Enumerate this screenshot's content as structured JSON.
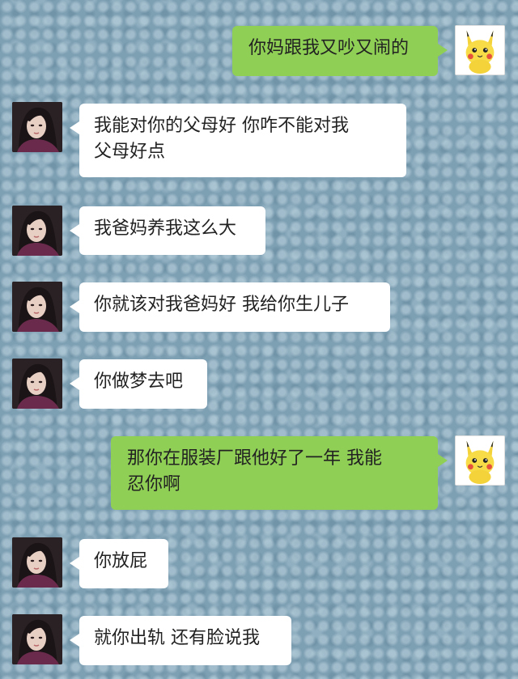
{
  "messages": [
    {
      "side": "sent",
      "text": "你妈跟我又吵又闹的"
    },
    {
      "side": "recv",
      "lines": [
        "我能对你的父母好 你咋不能对我",
        "父母好点"
      ]
    },
    {
      "side": "recv",
      "text": "我爸妈养我这么大"
    },
    {
      "side": "recv",
      "text": "你就该对我爸妈好 我给你生儿子"
    },
    {
      "side": "recv",
      "text": "你做梦去吧"
    },
    {
      "side": "sent",
      "lines": [
        "那你在服装厂跟他好了一年 我能",
        "忍你啊"
      ]
    },
    {
      "side": "recv",
      "text": "你放屁"
    },
    {
      "side": "recv",
      "text": "就你出轨 还有脸说我"
    }
  ],
  "avatars": {
    "self": "pikachu-avatar-icon",
    "other": "woman-portrait-avatar"
  },
  "colors": {
    "sent_bubble": "#8fcf55",
    "recv_bubble": "#ffffff",
    "background": "#7ea0b3"
  }
}
